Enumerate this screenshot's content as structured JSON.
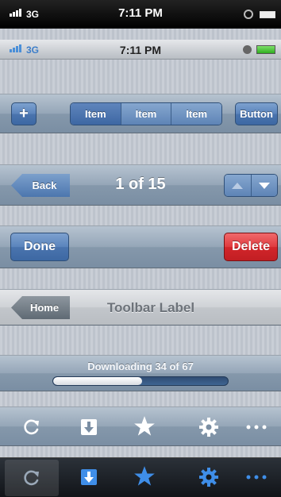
{
  "status_dark": {
    "carrier": "3G",
    "time": "7:11 PM"
  },
  "status_light": {
    "carrier": "3G",
    "time": "7:11 PM"
  },
  "toolbar_segmented": {
    "add_label": "+",
    "segments": [
      "Item",
      "Item",
      "Item"
    ],
    "button_label": "Button"
  },
  "toolbar_pager": {
    "back_label": "Back",
    "title": "1 of 15"
  },
  "toolbar_actions": {
    "done_label": "Done",
    "delete_label": "Delete"
  },
  "toolbar_label": {
    "home_label": "Home",
    "title": "Toolbar Label"
  },
  "toolbar_progress": {
    "text": "Downloading 34 of 67",
    "progress_fraction": 0.507
  },
  "toolbar_icons": {
    "icons": [
      "refresh-icon",
      "download-icon",
      "star-icon",
      "gear-icon",
      "more-icon"
    ]
  },
  "tabbar": {
    "icons": [
      "refresh-icon",
      "download-icon",
      "star-icon",
      "gear-icon",
      "more-icon"
    ],
    "selected_index": 0
  },
  "colors": {
    "accent_blue": "#3d68a3",
    "delete_red": "#d9252a",
    "progress_fill": "#f2f2f2"
  }
}
